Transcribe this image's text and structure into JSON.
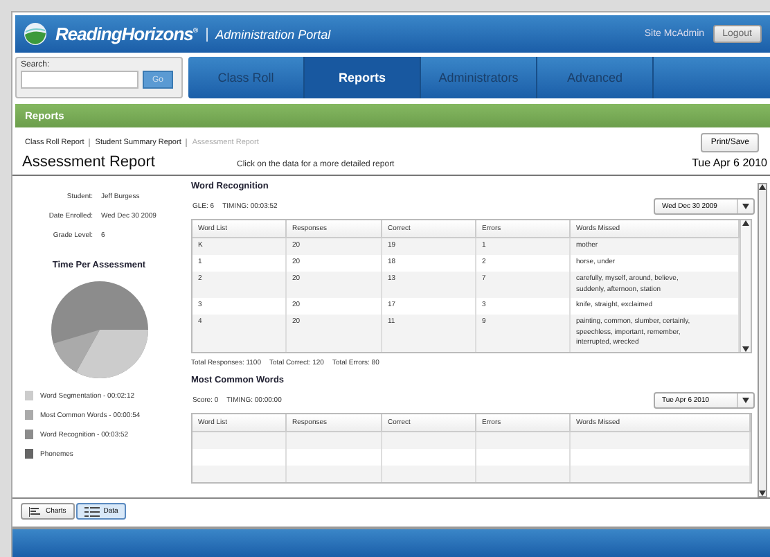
{
  "header": {
    "brand": "ReadingHorizons",
    "brand_mark": "®",
    "portal": "Administration Portal",
    "user": "Site McAdmin",
    "logout": "Logout"
  },
  "search": {
    "label": "Search:",
    "button": "Go"
  },
  "nav_tabs": [
    {
      "label": "Class Roll",
      "selected": false
    },
    {
      "label": "Reports",
      "selected": true
    },
    {
      "label": "Administrators",
      "selected": false
    },
    {
      "label": "Advanced",
      "selected": false
    }
  ],
  "section_title": "Reports",
  "breadcrumbs": [
    {
      "label": "Class Roll Report",
      "selected": false
    },
    {
      "label": "Student Summary Report",
      "selected": false
    },
    {
      "label": "Assessment Report",
      "selected": true
    }
  ],
  "print_button": "Print/Save",
  "page_title": "Assessment Report",
  "hint": "Click on the data for a more detailed report",
  "date": "Tue Apr 6 2010",
  "student_info": [
    {
      "label": "Student:",
      "value": "Jeff Burgess"
    },
    {
      "label": "Date Enrolled:",
      "value": "Wed Dec 30 2009"
    },
    {
      "label": "Grade Level:",
      "value": "6"
    }
  ],
  "pie": {
    "title": "Time Per Assessment",
    "legend": [
      {
        "label": "Word Segmentation - 00:02:12",
        "color": "#cccccc"
      },
      {
        "label": "Most Common Words - 00:00:54",
        "color": "#aaaaaa"
      },
      {
        "label": "Word Recognition - 00:03:52",
        "color": "#8c8c8c"
      },
      {
        "label": "Phonemes",
        "color": "#666666"
      }
    ]
  },
  "sections": [
    {
      "title": "Word Recognition",
      "stats": [
        "GLE: 6",
        "TIMING: 00:03:52"
      ],
      "date_select": "Wed Dec 30 2009",
      "columns": [
        "Word List",
        "Responses",
        "Correct",
        "Errors",
        "Words Missed"
      ],
      "rows": [
        [
          "K",
          "20",
          "19",
          "1",
          "mother"
        ],
        [
          "1",
          "20",
          "18",
          "2",
          "horse, under"
        ],
        [
          "2",
          "20",
          "13",
          "7",
          "carefully, myself, around, believe, suddenly, afternoon, station"
        ],
        [
          "3",
          "20",
          "17",
          "3",
          "knife, straight, exclaimed"
        ],
        [
          "4",
          "20",
          "11",
          "9",
          "painting, common, slumber, certainly, speechless, important, remember, interrupted, wrecked"
        ]
      ],
      "totals": [
        "Total Responses: 1100",
        "Total Correct: 120",
        "Total Errors: 80"
      ]
    },
    {
      "title": "Most Common Words",
      "stats": [
        "Score: 0",
        "TIMING: 00:00:00"
      ],
      "date_select": "Tue Apr 6 2010",
      "columns": [
        "Word List",
        "Responses",
        "Correct",
        "Errors",
        "Words Missed"
      ]
    }
  ],
  "view_toggle": [
    {
      "label": "Charts",
      "kind": "chart",
      "selected": false
    },
    {
      "label": "Data",
      "kind": "grid",
      "selected": true
    }
  ]
}
